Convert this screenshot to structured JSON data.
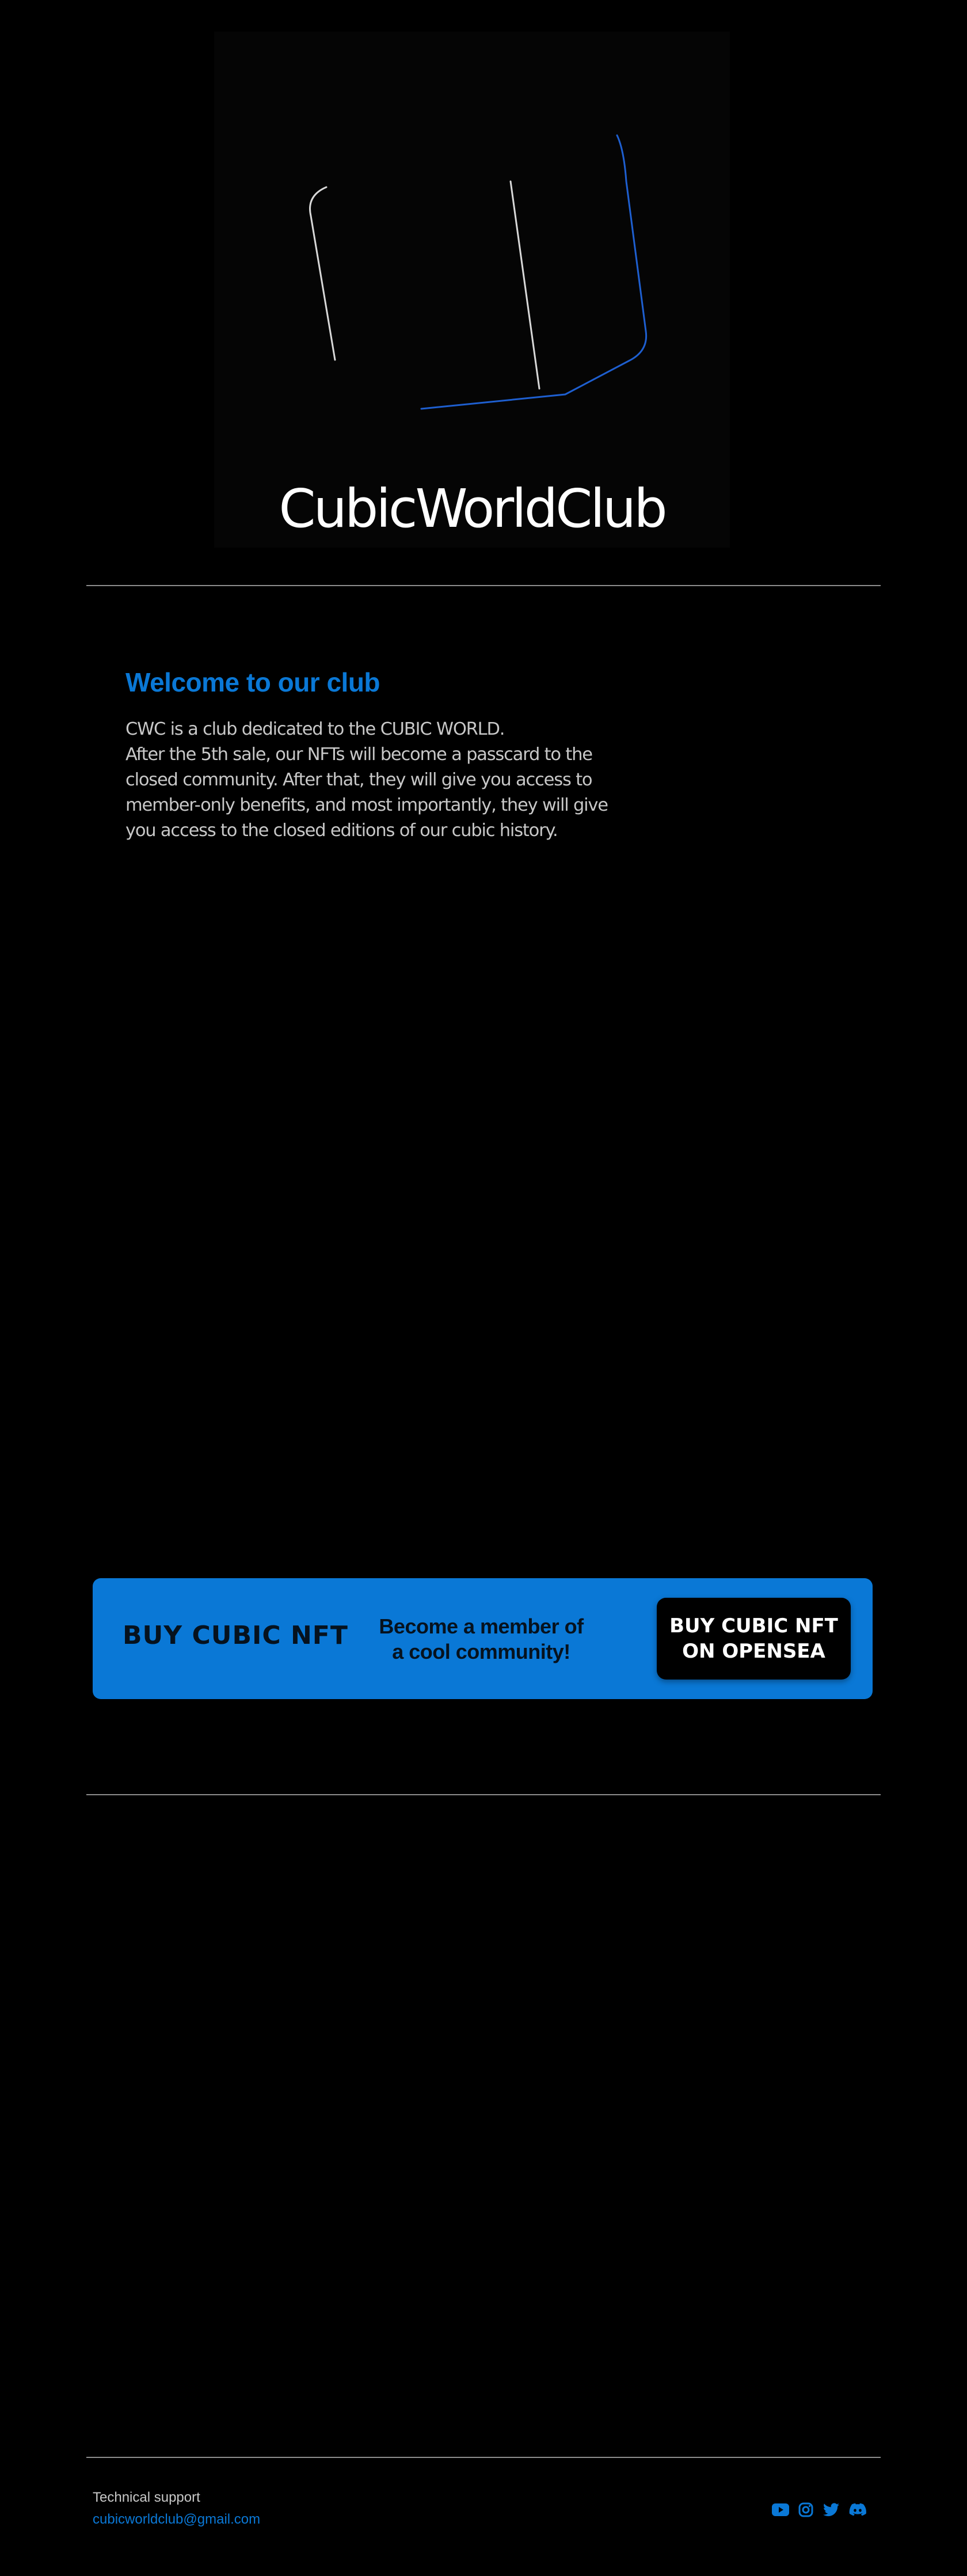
{
  "hero": {
    "title": "CubicWorldClub"
  },
  "welcome": {
    "heading": "Welcome to our club",
    "lines": [
      "CWC  is a club dedicated to the CUBIC WORLD.",
      "After the 5th sale, our NFTs will become a passcard to the",
      "closed community. After that, they will give you access to",
      "member-only benefits, and most importantly, they will give",
      "you access to the closed editions of our cubic history."
    ]
  },
  "cta": {
    "title": "BUY CUBIC NFT",
    "subtitle_lines": [
      "Become a member of",
      "a cool community!"
    ],
    "button_lines": [
      "BUY CUBIC NFT",
      "ON OPENSEA"
    ]
  },
  "footer": {
    "support_label": "Technical support",
    "support_email": "cubicworldclub@gmail.com",
    "social_icons": [
      "youtube-icon",
      "instagram-icon",
      "twitter-icon",
      "discord-icon"
    ]
  },
  "colors": {
    "accent": "#0a78d6",
    "background": "#000000",
    "text": "#c8c8c8"
  }
}
